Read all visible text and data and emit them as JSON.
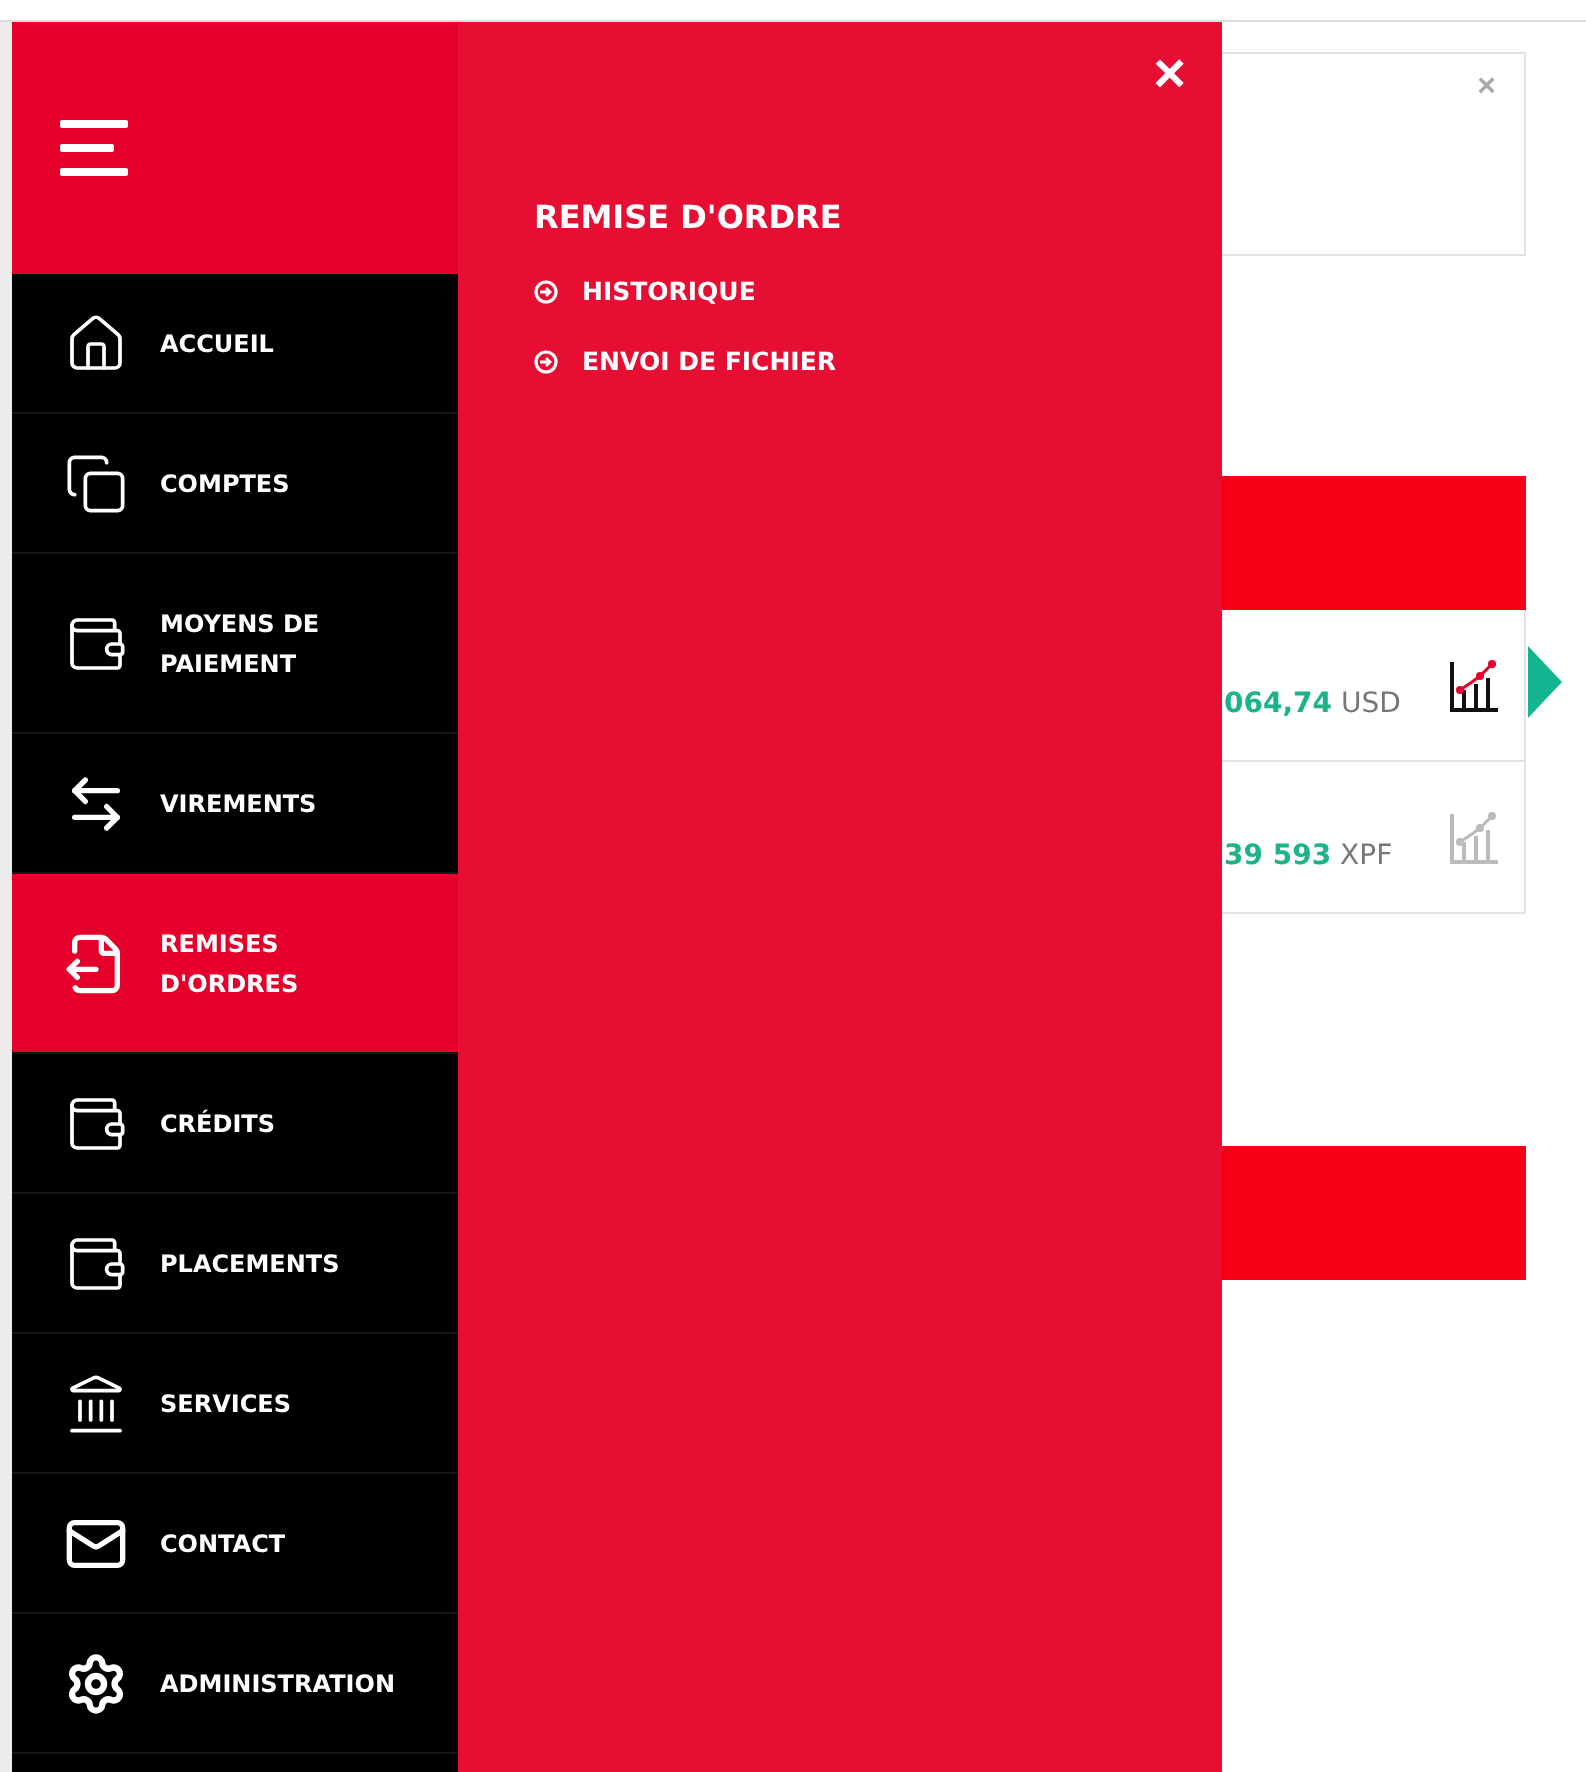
{
  "sidebar": {
    "items": [
      {
        "label": "ACCUEIL",
        "kind": "home",
        "selected": false
      },
      {
        "label": "COMPTES",
        "kind": "windows",
        "selected": false
      },
      {
        "label": "MOYENS DE PAIEMENT",
        "kind": "wallet",
        "selected": false
      },
      {
        "label": "VIREMENTS",
        "kind": "transfer",
        "selected": false
      },
      {
        "label": "REMISES D'ORDRES",
        "kind": "document",
        "selected": true
      },
      {
        "label": "CRÉDITS",
        "kind": "wallet",
        "selected": false
      },
      {
        "label": "PLACEMENTS",
        "kind": "wallet",
        "selected": false
      },
      {
        "label": "SERVICES",
        "kind": "bank",
        "selected": false
      },
      {
        "label": "CONTACT",
        "kind": "mail",
        "selected": false
      },
      {
        "label": "ADMINISTRATION",
        "kind": "gears",
        "selected": false
      }
    ]
  },
  "submenu": {
    "close": "×",
    "title": "REMISE D'ORDRE",
    "items": [
      "HISTORIQUE",
      "ENVOI DE FICHIER"
    ]
  },
  "notice_card": {
    "close": "×"
  },
  "accounts_summary": {
    "rows": [
      {
        "amount": "064,74",
        "currency": "USD",
        "selected": true
      },
      {
        "amount": "39 593",
        "currency": "XPF",
        "selected": false
      }
    ]
  }
}
